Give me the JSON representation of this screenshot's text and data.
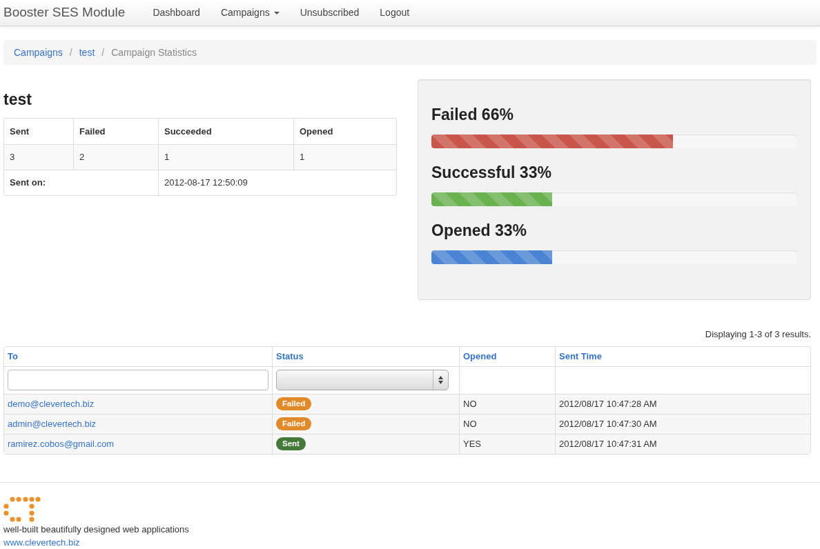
{
  "navbar": {
    "brand": "Booster SES Module",
    "items": [
      {
        "label": "Dashboard",
        "dropdown": false
      },
      {
        "label": "Campaigns",
        "dropdown": true
      },
      {
        "label": "Unsubscribed",
        "dropdown": false
      },
      {
        "label": "Logout",
        "dropdown": false
      }
    ]
  },
  "breadcrumb": [
    {
      "label": "Campaigns",
      "link": true
    },
    {
      "separator": "/",
      "label": "test",
      "link": true
    },
    {
      "separator": "/",
      "label": "Campaign Statistics",
      "link": false
    }
  ],
  "campaign": {
    "title": "test",
    "columns": [
      "Sent",
      "Failed",
      "Succeeded",
      "Opened"
    ],
    "values": [
      "3",
      "2",
      "1",
      "1"
    ],
    "sent_on_label": "Sent on:",
    "sent_on": "2012-08-17 12:50:09"
  },
  "stats": [
    {
      "label": "Failed 66%",
      "level": 0.66,
      "color": "#c9564b"
    },
    {
      "label": "Successful 33%",
      "level": 0.33,
      "color": "#6ab150"
    },
    {
      "label": "Opened 33%",
      "level": 0.33,
      "color": "#4a84d2"
    }
  ],
  "results": {
    "summary": "Displaying 1-3 of 3 results.",
    "columns": [
      "To",
      "Status",
      "Opened",
      "Sent Time"
    ],
    "rows": [
      {
        "to": "demo@clevertech.biz",
        "status": "Failed",
        "color": "#e08a2a",
        "opened": "NO",
        "sent_time": "2012/08/17 10:47:28 AM"
      },
      {
        "to": "admin@clevertech.biz",
        "status": "Failed",
        "color": "#e08a2a",
        "opened": "NO",
        "sent_time": "2012/08/17 10:47:30 AM"
      },
      {
        "to": "ramirez.cobos@gmail.com",
        "status": "Sent",
        "color": "#45793a",
        "opened": "YES",
        "sent_time": "2012/08/17 10:47:31 AM"
      }
    ]
  },
  "footer": {
    "tagline": "well-built beautifully designed web applications",
    "link": "www.clevertech.biz"
  }
}
